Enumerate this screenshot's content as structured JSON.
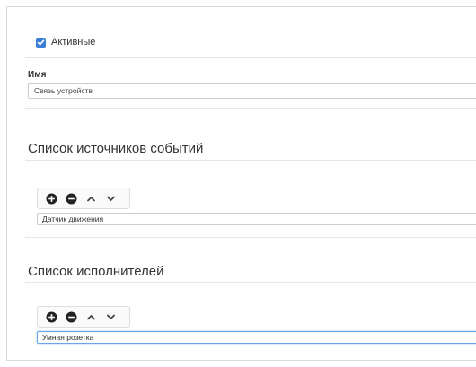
{
  "active": {
    "label": "Активные",
    "checked": true,
    "accent_color": "#3a7fd5"
  },
  "name_field": {
    "label": "Имя",
    "value": "Связь устройств"
  },
  "event_sources": {
    "title": "Список источников событий",
    "toolbar": [
      "add-icon",
      "remove-icon",
      "chevron-up-icon",
      "chevron-down-icon"
    ],
    "items": [
      "Датчик движения"
    ]
  },
  "executors": {
    "title": "Список исполнителей",
    "toolbar": [
      "add-icon",
      "remove-icon",
      "chevron-up-icon",
      "chevron-down-icon"
    ],
    "items": [
      "Умная розетка"
    ]
  }
}
